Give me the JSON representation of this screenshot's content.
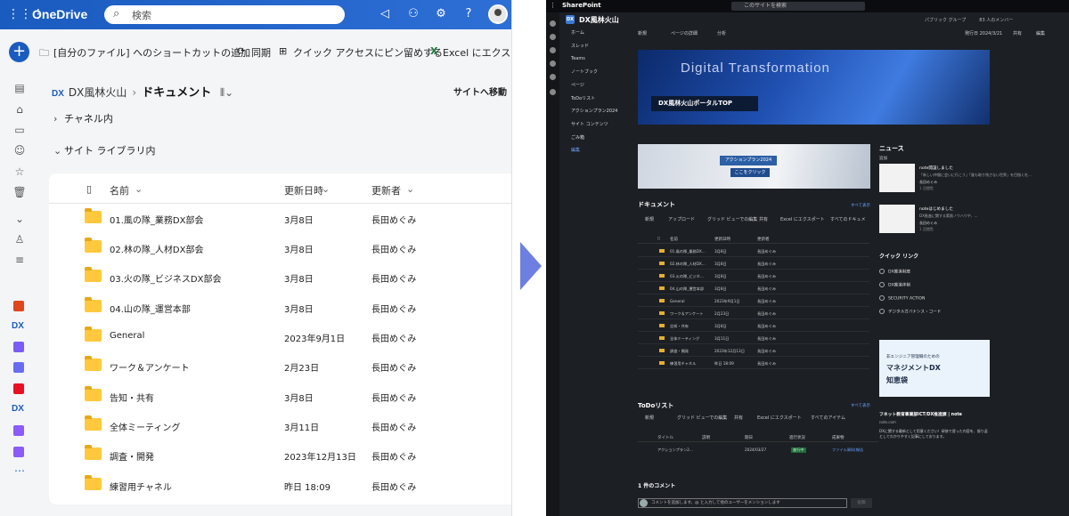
{
  "onedrive": {
    "brand": "OneDrive",
    "search_placeholder": "検索",
    "commands": {
      "shortcut": "[自分のファイル] へのショートカットの追加",
      "sync": "同期",
      "pin": "クイック アクセスにピン留めする",
      "excel": "Excel にエクスポー"
    },
    "breadcrumb": {
      "badge": "DX",
      "site": "DX風林火山",
      "current": "ドキュメント"
    },
    "goto_site": "サイトへ移動",
    "sections": {
      "channels": "チャネル内",
      "library": "サイト ライブラリ内"
    },
    "columns": {
      "name": "名前",
      "modified": "更新日時",
      "modified_by": "更新者"
    },
    "rows": [
      {
        "name": "01.風の隊_業務DX部会",
        "modified": "3月8日",
        "by": "長田めぐみ"
      },
      {
        "name": "02.林の隊_人材DX部会",
        "modified": "3月8日",
        "by": "長田めぐみ"
      },
      {
        "name": "03.火の隊_ビジネスDX部会",
        "modified": "3月8日",
        "by": "長田めぐみ"
      },
      {
        "name": "04.山の隊_運営本部",
        "modified": "3月8日",
        "by": "長田めぐみ"
      },
      {
        "name": "General",
        "modified": "2023年9月1日",
        "by": "長田めぐみ"
      },
      {
        "name": "ワーク＆アンケート",
        "modified": "2月23日",
        "by": "長田めぐみ"
      },
      {
        "name": "告知・共有",
        "modified": "3月8日",
        "by": "長田めぐみ"
      },
      {
        "name": "全体ミーティング",
        "modified": "3月11日",
        "by": "長田めぐみ"
      },
      {
        "name": "調査・開発",
        "modified": "2023年12月13日",
        "by": "長田めぐみ"
      },
      {
        "name": "練習用チャネル",
        "modified": "昨日 18:09",
        "by": "長田めぐみ"
      }
    ]
  },
  "sharepoint": {
    "brand": "SharePoint",
    "search_placeholder": "このサイトを検索",
    "site_name": "DX風林火山",
    "group_info": "パブリック グループ　　　83 人のメンバー",
    "published": "発行日 2024/3/21",
    "commands": {
      "new": "新規",
      "details": "ページの詳細",
      "analytics": "分析",
      "share": "共有",
      "edit": "編集"
    },
    "nav": [
      "ホーム",
      "スレッド",
      "Teams",
      "ノートブック",
      "ページ",
      "ToDoリスト",
      "アクションプラン2024",
      "サイト コンテンツ",
      "ごみ箱",
      "編集"
    ],
    "banner": {
      "heading": "Digital Transformation",
      "portal": "DX風林火山ポータルTOP"
    },
    "action_banner": {
      "label": "アクションプラン2024",
      "click": "ここをクリック"
    },
    "documents": {
      "title": "ドキュメント",
      "see_all": "すべて表示",
      "bar": [
        "新規",
        "アップロード",
        "グリッド ビューでの編集",
        "共有",
        "Excel にエクスポート",
        "すべてのドキュメ"
      ],
      "columns": [
        "名前",
        "更新日時",
        "更新者"
      ],
      "rows": [
        [
          "01.風の隊_業務DX...",
          "3月8日",
          "長田めぐみ"
        ],
        [
          "02.林の隊_人材DX...",
          "3月8日",
          "長田めぐみ"
        ],
        [
          "03.火の隊_ビジネ...",
          "3月8日",
          "長田めぐみ"
        ],
        [
          "04.山の隊_運営本部",
          "3月8日",
          "長田めぐみ"
        ],
        [
          "General",
          "2023年9月1日",
          "長田めぐみ"
        ],
        [
          "ワーク＆アンケート",
          "2月23日",
          "長田めぐみ"
        ],
        [
          "告知・共有",
          "3月8日",
          "長田めぐみ"
        ],
        [
          "全体ミーティング",
          "3月11日",
          "長田めぐみ"
        ],
        [
          "調査・開発",
          "2023年12月13日",
          "長田めぐみ"
        ],
        [
          "練習用チャネル",
          "昨日 18:09",
          "長田めぐみ"
        ]
      ]
    },
    "todo": {
      "title": "ToDoリスト",
      "see_all": "すべて表示",
      "bar": [
        "新規",
        "グリッド ビューでの編集",
        "共有",
        "Excel にエクスポート",
        "すべてのアイテム"
      ],
      "columns": [
        "タイトル",
        "説明",
        "期日",
        "進行状況",
        "成果物"
      ],
      "row": {
        "title": "アクションプラン2...",
        "due": "2024/03/27",
        "status": "進行中",
        "deliverable": "ファイル資料(報告"
      }
    },
    "comments": {
      "title": "1 件のコメント",
      "placeholder": "コメントを追加します。@ と入力して他のユーザーをメンションします",
      "post": "投稿"
    },
    "news": {
      "title": "ニュース",
      "add": "追加",
      "items": [
        {
          "title": "note開設しました",
          "desc": "「新しい仲間に会いに行こう」「誰も取り残さない世界」を目指く社...",
          "author": "長田めぐみ",
          "views": "1 回閲覧"
        },
        {
          "title": "noteはじめました",
          "desc": "DX推進に関する実践ノウハウや、...",
          "author": "長田めぐみ",
          "views": "1 回閲覧"
        }
      ]
    },
    "quick_links": {
      "title": "クイック リンク",
      "items": [
        "DX推進制度",
        "DX推進体制",
        "SECURITY ACTION",
        "デジタルガバナンス・コード"
      ]
    },
    "promo": {
      "line1": "非エンジニア管理職のための",
      "line2": "マネジメントDX",
      "line3": "知恵袋"
    },
    "promo_caption": {
      "title": "フネット教育事業部ICT/DX推進課 | note",
      "site": "note.com",
      "desc": "DXに関する最新として用意ください！研修で習った内容を、振り返としてわかりやすく記事にしております。"
    }
  }
}
